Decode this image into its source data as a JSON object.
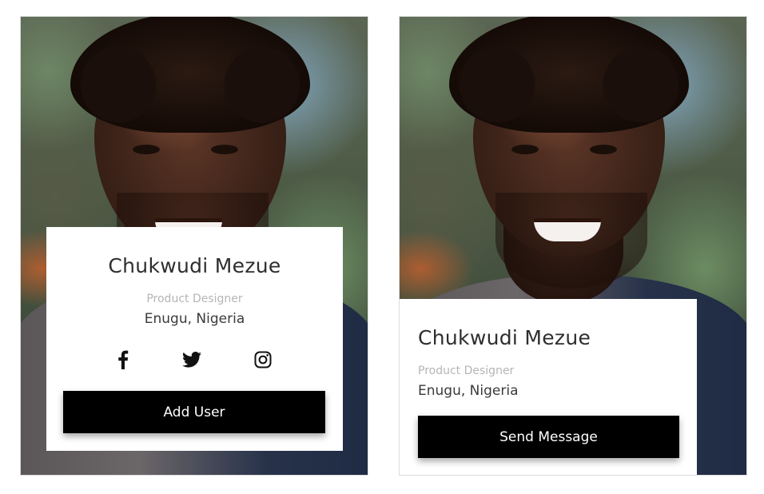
{
  "cards": [
    {
      "name": "Chukwudi Mezue",
      "role": "Product Designer",
      "location": "Enugu, Nigeria",
      "socials": [
        "facebook-icon",
        "twitter-icon",
        "instagram-icon"
      ],
      "button_label": "Add User"
    },
    {
      "name": "Chukwudi Mezue",
      "role": "Product Designer",
      "location": "Enugu, Nigeria",
      "button_label": "Send Message"
    }
  ],
  "colors": {
    "button_bg": "#000000",
    "button_text": "#ffffff",
    "name_text": "#2e2e2e",
    "role_text": "#b5b5b5",
    "location_text": "#3a3a3a",
    "card_border": "#dcdcdc"
  }
}
